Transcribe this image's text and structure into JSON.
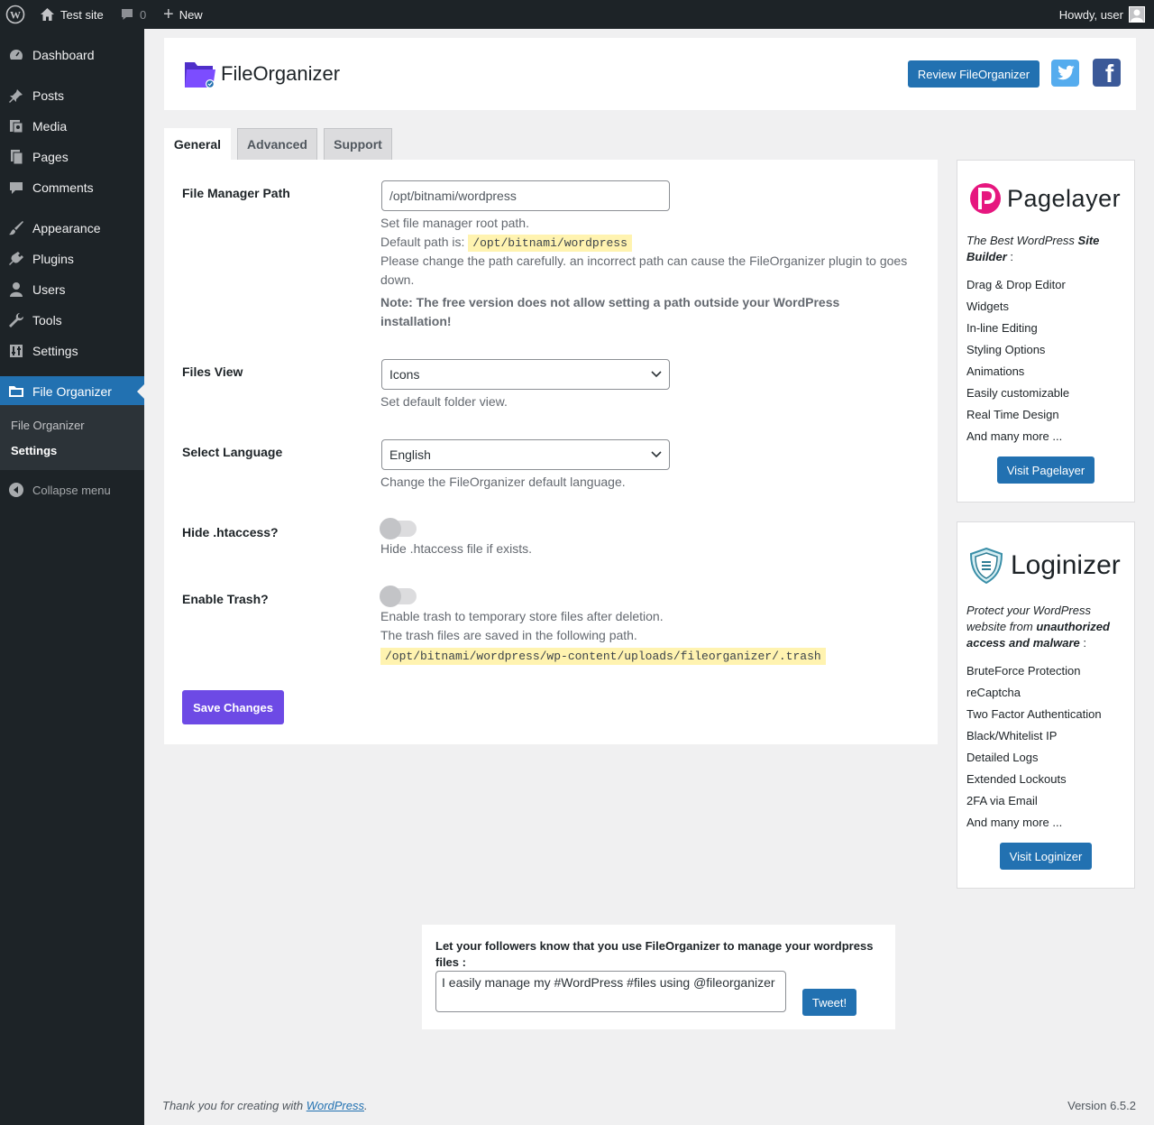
{
  "admin_bar": {
    "site_name": "Test site",
    "comments_count": "0",
    "new_label": "New",
    "greeting": "Howdy, user"
  },
  "sidebar": {
    "items": [
      {
        "label": "Dashboard",
        "icon": "dashboard-icon"
      },
      {
        "label": "Posts",
        "icon": "pushpin-icon"
      },
      {
        "label": "Media",
        "icon": "media-icon"
      },
      {
        "label": "Pages",
        "icon": "page-icon"
      },
      {
        "label": "Comments",
        "icon": "comment-icon"
      },
      {
        "label": "Appearance",
        "icon": "paintbrush-icon"
      },
      {
        "label": "Plugins",
        "icon": "plug-icon"
      },
      {
        "label": "Users",
        "icon": "user-icon"
      },
      {
        "label": "Tools",
        "icon": "wrench-icon"
      },
      {
        "label": "Settings",
        "icon": "settings-sliders-icon"
      },
      {
        "label": "File Organizer",
        "icon": "folder-icon"
      }
    ],
    "submenu": [
      "File Organizer",
      "Settings"
    ],
    "collapse_label": "Collapse menu"
  },
  "header": {
    "title": "FileOrganizer",
    "review_button": "Review FileOrganizer"
  },
  "tabs": [
    "General",
    "Advanced",
    "Support"
  ],
  "form": {
    "path": {
      "label": "File Manager Path",
      "value": "/opt/bitnami/wordpress",
      "desc1": "Set file manager root path.",
      "default_prefix": "Default path is:",
      "default_value": "/opt/bitnami/wordpress",
      "warning": "Please change the path carefully. an incorrect path can cause the FileOrganizer plugin to goes down.",
      "note": "Note: The free version does not allow setting a path outside your WordPress installation!"
    },
    "view": {
      "label": "Files View",
      "selected": "Icons",
      "desc": "Set default folder view."
    },
    "language": {
      "label": "Select Language",
      "selected": "English",
      "desc": "Change the FileOrganizer default language."
    },
    "htaccess": {
      "label": "Hide .htaccess?",
      "enabled": false,
      "desc": "Hide .htaccess file if exists."
    },
    "trash": {
      "label": "Enable Trash?",
      "enabled": false,
      "desc1": "Enable trash to temporary store files after deletion.",
      "desc2": "The trash files are saved in the following path.",
      "path": "/opt/bitnami/wordpress/wp-content/uploads/fileorganizer/.trash"
    },
    "save_label": "Save Changes"
  },
  "pagelayer": {
    "brand": "Pagelayer",
    "tagline_a": "The Best WordPress ",
    "tagline_b": "Site Builder",
    "tagline_c": " :",
    "features": [
      "Drag & Drop Editor",
      "Widgets",
      "In-line Editing",
      "Styling Options",
      "Animations",
      "Easily customizable",
      "Real Time Design",
      "And many more ..."
    ],
    "button": "Visit Pagelayer"
  },
  "loginizer": {
    "brand": "Loginizer",
    "tagline_a": "Protect your WordPress website from ",
    "tagline_b": "unauthorized access and malware",
    "tagline_c": " :",
    "features": [
      "BruteForce Protection",
      "reCaptcha",
      "Two Factor Authentication",
      "Black/Whitelist IP",
      "Detailed Logs",
      "Extended Lockouts",
      "2FA via Email",
      "And many more ..."
    ],
    "button": "Visit Loginizer"
  },
  "tweet": {
    "prompt": "Let your followers know that you use FileOrganizer to manage your wordpress files :",
    "text": "I easily manage my #WordPress #files using @fileorganizer",
    "button": "Tweet!"
  },
  "footer": {
    "thanks_prefix": "Thank you for creating with ",
    "thanks_link": "WordPress",
    "thanks_suffix": ".",
    "version": "Version 6.5.2"
  },
  "colors": {
    "admin_dark": "#1d2327",
    "wp_blue": "#2271b1",
    "save_purple": "#6d4ae5",
    "code_highlight": "#fff3b0"
  }
}
